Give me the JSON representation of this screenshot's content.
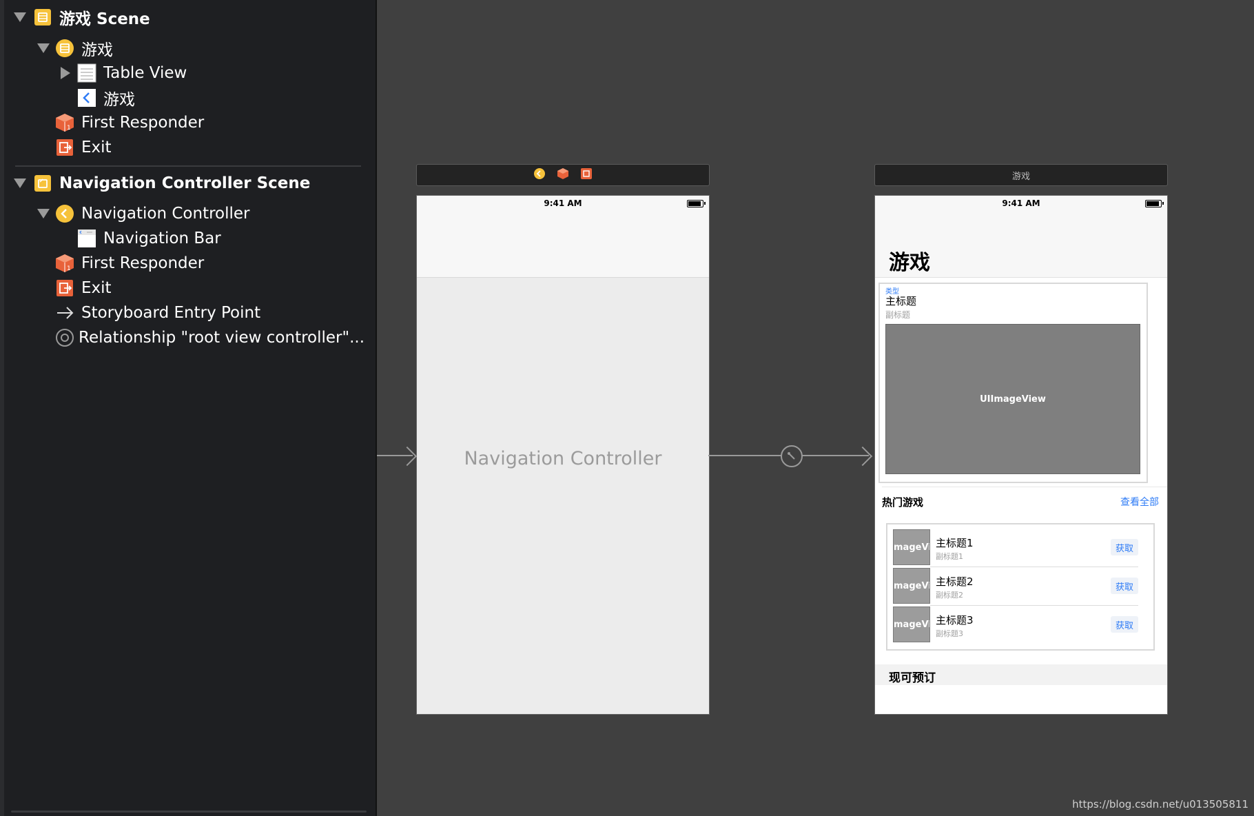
{
  "outline": {
    "scene1": {
      "title": "游戏 Scene",
      "items": [
        {
          "label": "游戏"
        },
        {
          "label": "Table View"
        },
        {
          "label": "游戏"
        },
        {
          "label": "First Responder"
        },
        {
          "label": "Exit"
        }
      ]
    },
    "scene2": {
      "title": "Navigation Controller Scene",
      "items": [
        {
          "label": "Navigation Controller"
        },
        {
          "label": "Navigation Bar"
        },
        {
          "label": "First Responder"
        },
        {
          "label": "Exit"
        },
        {
          "label": "Storyboard Entry Point"
        },
        {
          "label": "Relationship \"root view controller\"..."
        }
      ]
    }
  },
  "canvas": {
    "nav_phone": {
      "status_time": "9:41 AM",
      "center_label": "Navigation Controller"
    },
    "game_phone": {
      "scene_bar_title": "游戏",
      "status_time": "9:41 AM",
      "large_title": "游戏",
      "card": {
        "type_label": "类型",
        "title": "主标题",
        "subtitle": "副标题",
        "image_label": "UIImageView"
      },
      "hot_section": {
        "title": "热门游戏",
        "see_all": "查看全部"
      },
      "hot_items": [
        {
          "thumb": "mageVi",
          "title": "主标题1",
          "subtitle": "副标题1",
          "button": "获取"
        },
        {
          "thumb": "mageVi",
          "title": "主标题2",
          "subtitle": "副标题2",
          "button": "获取"
        },
        {
          "thumb": "mageVi",
          "title": "主标题3",
          "subtitle": "副标题3",
          "button": "获取"
        }
      ],
      "preorder_title": "现可预订"
    }
  },
  "watermark": "https://blog.csdn.net/u013505811",
  "colors": {
    "accent_blue": "#2f7cf6",
    "icon_yellow": "#f6c23b",
    "icon_orange": "#e8623a"
  }
}
